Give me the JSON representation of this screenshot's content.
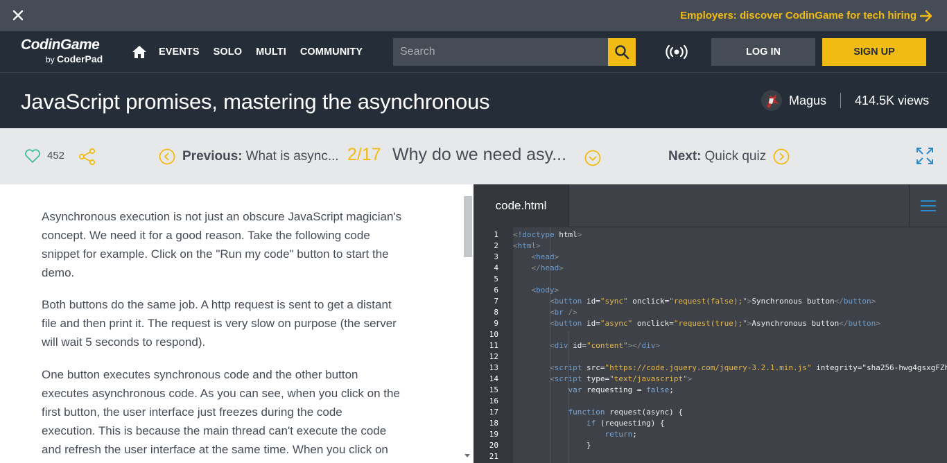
{
  "banner": {
    "promo": "Employers: discover CodinGame for tech hiring"
  },
  "nav": {
    "logo_line1": "CodinGame",
    "logo_by": "by",
    "logo_line2": "CoderPad",
    "links": [
      "EVENTS",
      "SOLO",
      "MULTI",
      "COMMUNITY"
    ],
    "search_placeholder": "Search",
    "login": "LOG IN",
    "signup": "SIGN UP"
  },
  "page": {
    "title": "JavaScript promises, mastering the asynchronous",
    "author": "Magus",
    "views": "414.5K views"
  },
  "lesson": {
    "likes": "452",
    "prev_label": "Previous:",
    "prev_title": "What is async...",
    "step": "2/17",
    "title": "Why do we need asy...",
    "next_label": "Next:",
    "next_title": "Quick quiz"
  },
  "article": {
    "paragraphs": [
      [
        "Asynchronous execution is not just an obscure JavaScript magician's",
        "concept. We need it for a good reason. Take the following code",
        "snippet for example. Click on the \"Run my code\" button to start the",
        "demo."
      ],
      [
        "Both buttons do the same job. A http request is sent to get a distant",
        "file and then print it. The request is very slow on purpose (the server",
        "will wait 5 seconds to respond)."
      ],
      [
        "One button executes synchronous code and the other button",
        "executes asynchronous code. As you can see, when you click on the",
        "first button, the user interface just freezes during the code",
        "execution. This is because the main thread can't execute the code",
        "and refresh the user interface at the same time. When you click on"
      ]
    ]
  },
  "editor": {
    "tab": "code.html",
    "line_numbers": [
      "1",
      "2",
      "3",
      "4",
      "5",
      "6",
      "7",
      "8",
      "9",
      "10",
      "11",
      "12",
      "13",
      "14",
      "15",
      "16",
      "17",
      "18",
      "19",
      "20",
      "21"
    ],
    "lines": [
      "<!doctype html>",
      "<html>",
      "    <head>",
      "    </head>",
      "",
      "    <body>",
      "        <button id=\"sync\" onclick=\"request(false);\">Synchronous button</button>",
      "        <br />",
      "        <button id=\"async\" onclick=\"request(true);\">Asynchronous button</button>",
      "",
      "        <div id=\"content\"></div>",
      "",
      "        <script src=\"https://code.jquery.com/jquery-3.2.1.min.js\" integrity=\"sha256-hwg4gsxgFZh",
      "        <script type=\"text/javascript\">",
      "            var requesting = false;",
      "",
      "            function request(async) {",
      "                if (requesting) {",
      "                    return;",
      "                }",
      ""
    ]
  },
  "colors": {
    "accent": "#f2bb13",
    "dark": "#252e38",
    "banner": "#454c55"
  }
}
